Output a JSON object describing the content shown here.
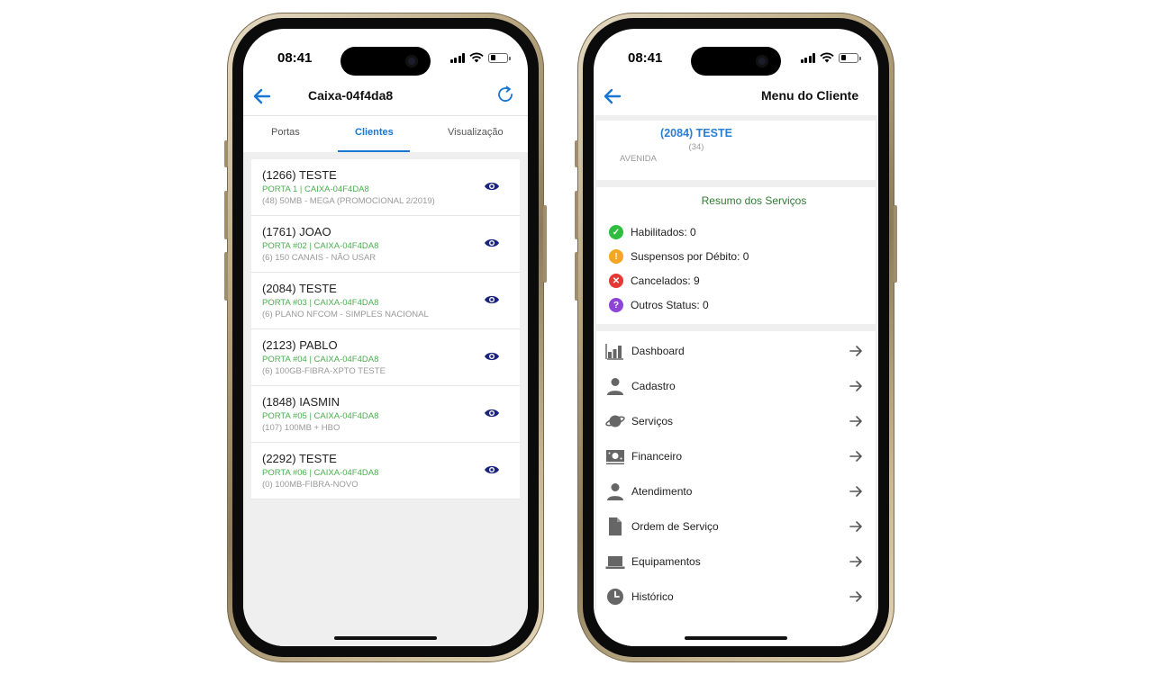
{
  "status_bar": {
    "time": "08:41"
  },
  "phone1": {
    "title": "Caixa-04f4da8",
    "tabs": [
      {
        "label": "Portas",
        "active": false
      },
      {
        "label": "Clientes",
        "active": true
      },
      {
        "label": "Visualização",
        "active": false
      }
    ],
    "clients": [
      {
        "name": "(1266) TESTE",
        "port": "PORTA 1 | CAIXA-04F4DA8",
        "plan": "(48) 50MB - MEGA (PROMOCIONAL 2/2019)"
      },
      {
        "name": "(1761) JOAO",
        "port": "PORTA #02 | CAIXA-04F4DA8",
        "plan": "(6) 150 CANAIS - NÃO USAR"
      },
      {
        "name": "(2084) TESTE",
        "port": "PORTA #03 | CAIXA-04F4DA8",
        "plan": "(6) PLANO NFCOM - SIMPLES NACIONAL"
      },
      {
        "name": "(2123) PABLO",
        "port": "PORTA #04 | CAIXA-04F4DA8",
        "plan": "(6) 100GB-FIBRA-XPTO TESTE"
      },
      {
        "name": "(1848) IASMIN",
        "port": "PORTA #05 | CAIXA-04F4DA8",
        "plan": "(107) 100MB + HBO"
      },
      {
        "name": "(2292) TESTE",
        "port": "PORTA #06 | CAIXA-04F4DA8",
        "plan": "(0) 100MB-FIBRA-NOVO"
      }
    ]
  },
  "phone2": {
    "title": "Menu do Cliente",
    "client": {
      "name": "(2084) TESTE",
      "number": "(34)",
      "address": "AVENIDA"
    },
    "summary": {
      "title": "Resumo dos Serviços",
      "rows": [
        {
          "label": "Habilitados: 0",
          "color": "#2ebd3f",
          "icon": "check-icon",
          "glyph": "✓"
        },
        {
          "label": "Suspensos por Débito: 0",
          "color": "#f5a623",
          "icon": "exclamation-icon",
          "glyph": "!"
        },
        {
          "label": "Cancelados: 9",
          "color": "#e53935",
          "icon": "close-icon",
          "glyph": "✕"
        },
        {
          "label": "Outros Status: 0",
          "color": "#8e44d6",
          "icon": "question-icon",
          "glyph": "?"
        }
      ]
    },
    "menu": [
      {
        "label": "Dashboard",
        "icon": "bar-chart-icon"
      },
      {
        "label": "Cadastro",
        "icon": "person-icon"
      },
      {
        "label": "Serviços",
        "icon": "planet-icon"
      },
      {
        "label": "Financeiro",
        "icon": "money-icon"
      },
      {
        "label": "Atendimento",
        "icon": "person-icon"
      },
      {
        "label": "Ordem de Serviço",
        "icon": "document-icon"
      },
      {
        "label": "Equipamentos",
        "icon": "laptop-icon"
      },
      {
        "label": "Histórico",
        "icon": "clock-icon"
      }
    ]
  },
  "colors": {
    "accent": "#1976d2",
    "green_text": "#4caf50",
    "eye": "#1a237e"
  }
}
